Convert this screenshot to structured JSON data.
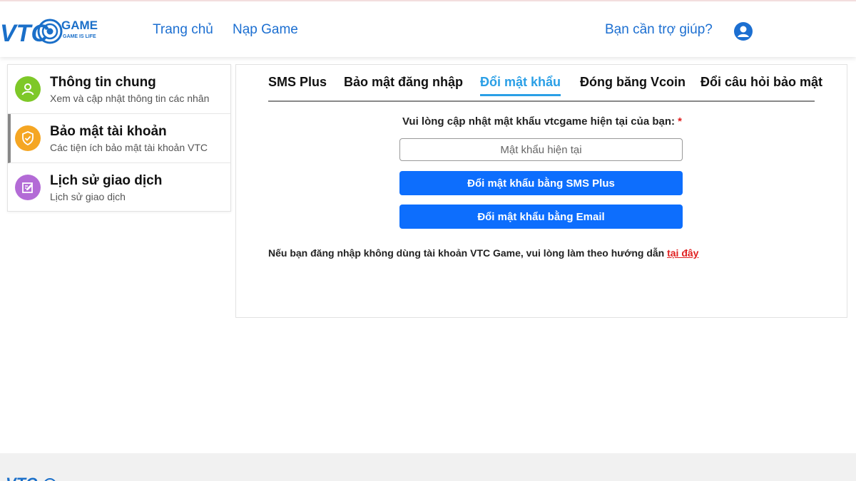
{
  "header": {
    "logo": {
      "brand": "VTC",
      "game": "GAME",
      "tagline": "GAME IS LIFE"
    },
    "nav": [
      {
        "label": "Trang chủ"
      },
      {
        "label": "Nạp Game"
      }
    ],
    "help_label": "Bạn cần trợ giúp?",
    "user_icon": "user-circle-icon"
  },
  "sidebar": {
    "items": [
      {
        "title": "Thông tin chung",
        "subtitle": "Xem và cập nhật thông tin các nhân",
        "icon": "user-icon",
        "color": "#7ec828",
        "active": false
      },
      {
        "title": "Bảo mật tài khoản",
        "subtitle": "Các tiện ích bảo mật tài khoản VTC",
        "icon": "shield-check-icon",
        "color": "#f5a623",
        "active": true
      },
      {
        "title": "Lịch sử giao dịch",
        "subtitle": "Lịch sử giao dịch",
        "icon": "edit-note-icon",
        "color": "#b36bd6",
        "active": false
      }
    ]
  },
  "main": {
    "tabs": [
      {
        "label": "SMS Plus",
        "active": false
      },
      {
        "label": "Bảo mật đăng nhập",
        "active": false
      },
      {
        "label": "Đổi mật khẩu",
        "active": true
      },
      {
        "label": "Đóng băng Vcoin",
        "active": false
      },
      {
        "label": "Đổi câu hỏi bảo mật",
        "active": false
      }
    ],
    "prompt": "Vui lòng cập nhật mật khẩu vtcgame hiện tại của bạn:",
    "required_mark": "*",
    "password_placeholder": "Mật khẩu hiện tại",
    "password_value": "",
    "btn_sms": "Đổi mật khẩu bằng SMS Plus",
    "btn_email": "Đổi mật khẩu bằng Email",
    "note_text": "Nếu bạn đăng nhập không dùng tài khoản VTC Game, vui lòng làm theo hướng dẫn ",
    "note_link": "tại đây"
  },
  "colors": {
    "primary": "#0d6efd",
    "nav_link": "#1c6fd1",
    "tab_active": "#2a9fe6",
    "required": "#e02020"
  }
}
